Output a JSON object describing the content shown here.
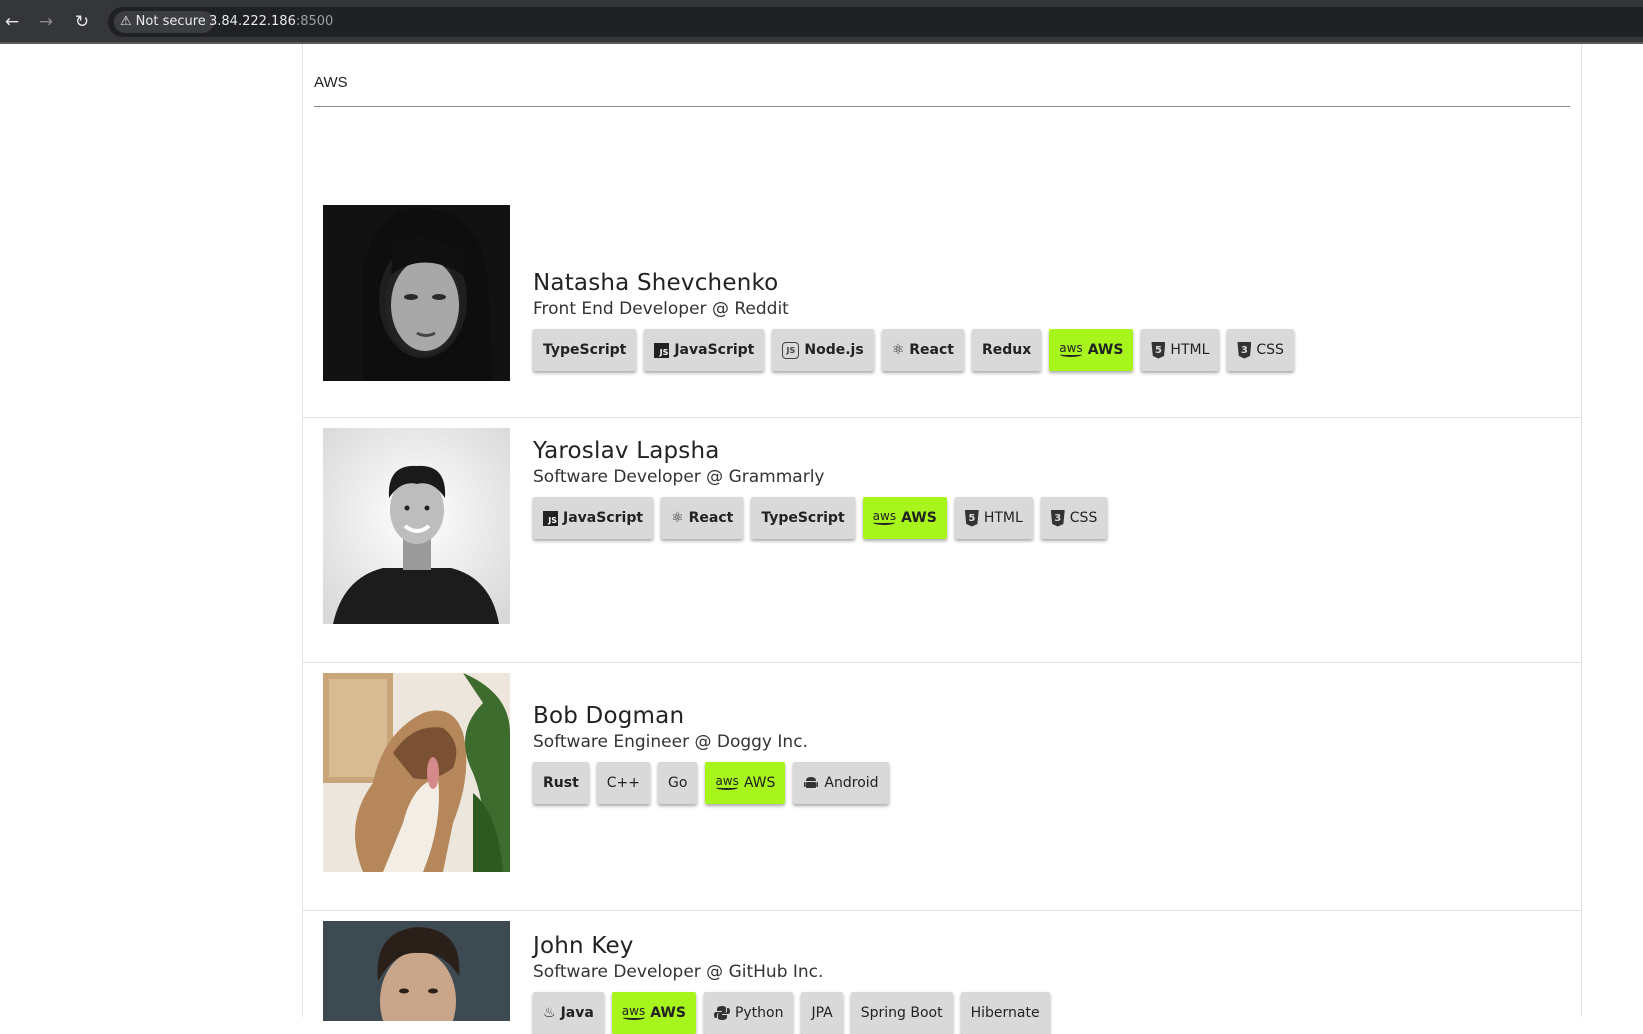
{
  "browser": {
    "security_label": "Not secure",
    "url_host": "3.84.222.186",
    "url_port": ":8500"
  },
  "section": {
    "title": "AWS"
  },
  "people": [
    {
      "name": "Natasha Shevchenko",
      "role": "Front End Developer @ Reddit",
      "skills": [
        {
          "label": "TypeScript",
          "icon": "",
          "bold": true
        },
        {
          "label": "JavaScript",
          "icon": "js-icon",
          "bold": true
        },
        {
          "label": "Node.js",
          "icon": "nodejs-icon",
          "bold": true
        },
        {
          "label": "React",
          "icon": "react-icon",
          "bold": true
        },
        {
          "label": "Redux",
          "icon": "",
          "bold": true
        },
        {
          "label": "AWS",
          "icon": "aws-icon",
          "bold": true,
          "highlight": true
        },
        {
          "label": "HTML",
          "icon": "html5-icon",
          "bold": false
        },
        {
          "label": "CSS",
          "icon": "css3-icon",
          "bold": false
        }
      ]
    },
    {
      "name": "Yaroslav Lapsha",
      "role": "Software Developer @ Grammarly",
      "skills": [
        {
          "label": "JavaScript",
          "icon": "js-icon",
          "bold": true
        },
        {
          "label": "React",
          "icon": "react-icon",
          "bold": true
        },
        {
          "label": "TypeScript",
          "icon": "",
          "bold": true
        },
        {
          "label": "AWS",
          "icon": "aws-icon",
          "bold": true,
          "highlight": true
        },
        {
          "label": "HTML",
          "icon": "html5-icon",
          "bold": false
        },
        {
          "label": "CSS",
          "icon": "css3-icon",
          "bold": false
        }
      ]
    },
    {
      "name": "Bob Dogman",
      "role": "Software Engineer @ Doggy Inc.",
      "skills": [
        {
          "label": "Rust",
          "icon": "",
          "bold": true
        },
        {
          "label": "C++",
          "icon": "",
          "bold": false
        },
        {
          "label": "Go",
          "icon": "",
          "bold": false
        },
        {
          "label": "AWS",
          "icon": "aws-icon",
          "bold": false,
          "highlight": true
        },
        {
          "label": "Android",
          "icon": "android-icon",
          "bold": false
        }
      ]
    },
    {
      "name": "John Key",
      "role": "Software Developer @ GitHub Inc.",
      "skills": [
        {
          "label": "Java",
          "icon": "java-icon",
          "bold": true
        },
        {
          "label": "AWS",
          "icon": "aws-icon",
          "bold": true,
          "highlight": true
        },
        {
          "label": "Python",
          "icon": "python-icon",
          "bold": false
        },
        {
          "label": "JPA",
          "icon": "",
          "bold": false
        },
        {
          "label": "Spring Boot",
          "icon": "",
          "bold": false
        },
        {
          "label": "Hibernate",
          "icon": "",
          "bold": false
        }
      ]
    }
  ],
  "colors": {
    "aws_highlight": "#a8f51e",
    "chip_bg": "#d9d9d9"
  }
}
